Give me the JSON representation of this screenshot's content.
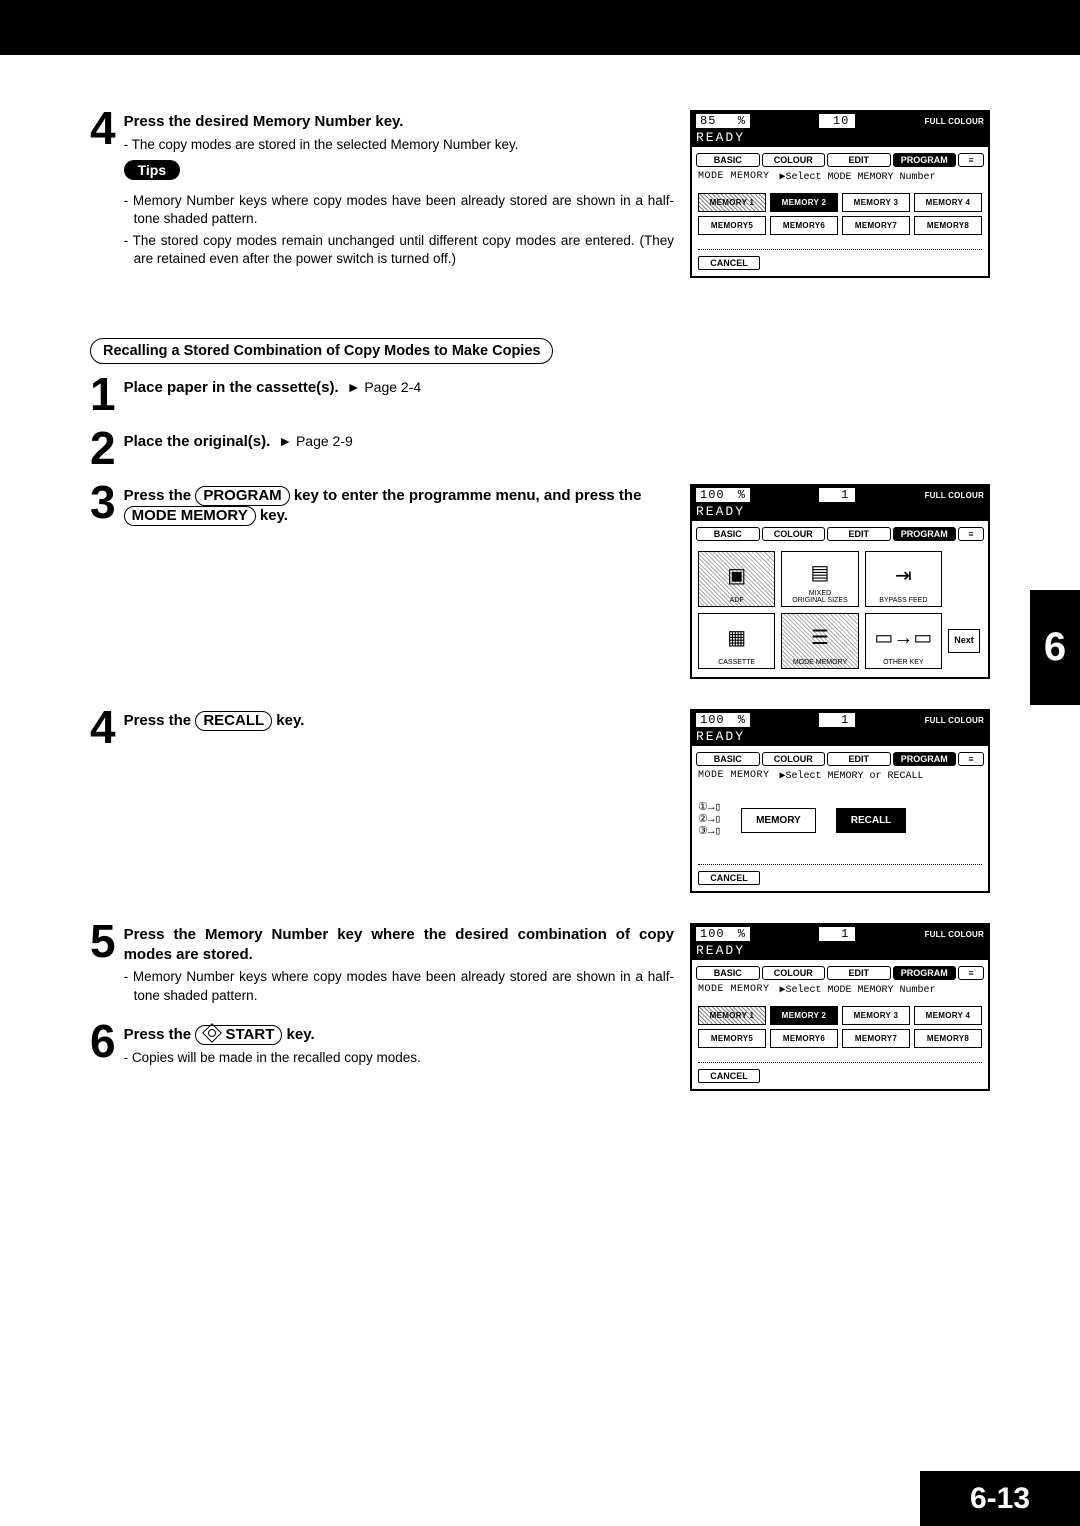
{
  "chapter_tab": "6",
  "page_number": "6-13",
  "step4a": {
    "num": "4",
    "title": "Press the desired Memory Number key.",
    "sub1": "-  The copy modes are stored in the selected Memory Number key.",
    "tips_label": "Tips",
    "tip1": "-  Memory Number keys where copy modes have been already stored are shown in a half-tone shaded pattern.",
    "tip2": "-  The stored copy modes remain unchanged until different copy modes are entered. (They are retained even after the power switch is turned off.)"
  },
  "section_title": "Recalling a Stored Combination of Copy Modes to Make Copies",
  "step1": {
    "num": "1",
    "title": "Place paper in the cassette(s).",
    "page_ref": "Page 2-4"
  },
  "step2": {
    "num": "2",
    "title": "Place the original(s).",
    "page_ref": "Page 2-9"
  },
  "step3": {
    "num": "3",
    "pre": "Press the ",
    "key1": "PROGRAM",
    "mid": " key to enter the programme menu, and  press the ",
    "key2": "MODE MEMORY",
    "post": " key."
  },
  "step4b": {
    "num": "4",
    "pre": "Press the ",
    "key": "RECALL",
    "post": " key."
  },
  "step5": {
    "num": "5",
    "title": "Press the Memory Number key where the desired combination of copy modes are stored.",
    "sub": "-  Memory Number keys where copy modes have been already stored are shown in a half-tone shaded pattern."
  },
  "step6": {
    "num": "6",
    "pre": "Press the ",
    "key": "START",
    "post": " key.",
    "sub": "-  Copies will be made in the recalled copy modes."
  },
  "lcd_common": {
    "ready": "READY",
    "full": "FULL COLOUR",
    "tabs": {
      "basic": "BASIC",
      "colour": "COLOUR",
      "edit": "EDIT",
      "program": "PROGRAM",
      "icon": "≡"
    },
    "cancel": "CANCEL",
    "mode_memory": "MODE MEMORY",
    "memory_buttons": [
      "MEMORY 1",
      "MEMORY 2",
      "MEMORY 3",
      "MEMORY 4",
      "MEMORY5",
      "MEMORY6",
      "MEMORY7",
      "MEMORY8"
    ]
  },
  "lcd1": {
    "zoom": "85",
    "zoom_pct": "%",
    "count": "10",
    "prompt": "▶Select MODE MEMORY Number"
  },
  "lcd2": {
    "zoom": "100",
    "zoom_pct": "%",
    "count": "1",
    "cells": {
      "adf": "ADF",
      "mixed": "MIXED\nORIGINAL SIZES",
      "bypass": "BYPASS FEED",
      "cassette": "CASSETTE",
      "mode_mem": "MODE MEMORY",
      "other": "OTHER KEY",
      "next": "Next"
    }
  },
  "lcd3": {
    "zoom": "100",
    "zoom_pct": "%",
    "count": "1",
    "prompt": "▶Select MEMORY or RECALL",
    "memory_btn": "MEMORY",
    "recall_btn": "RECALL"
  },
  "lcd4": {
    "zoom": "100",
    "zoom_pct": "%",
    "count": "1",
    "prompt": "▶Select MODE MEMORY Number"
  }
}
